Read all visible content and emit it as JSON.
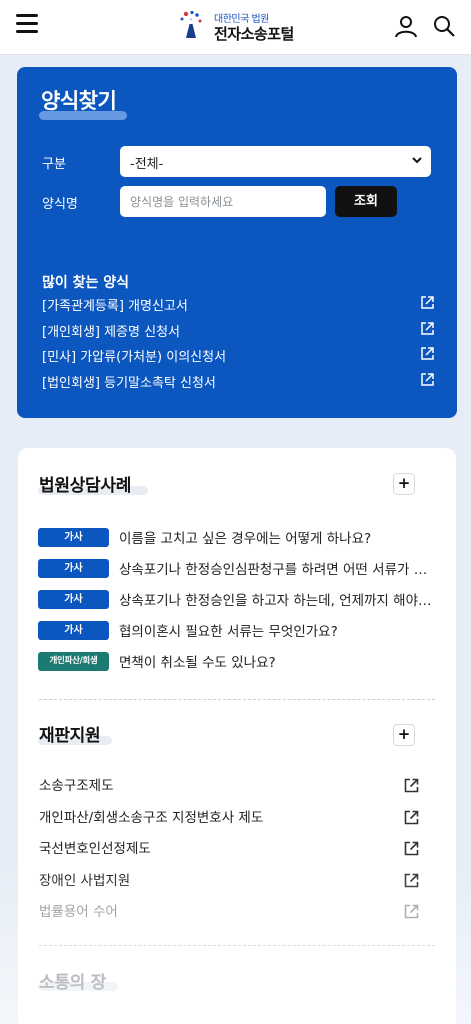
{
  "header": {
    "logo_sub": "대한민국 법원",
    "logo_title": "전자소송포털"
  },
  "finder": {
    "title": "양식찾기",
    "category_label": "구분",
    "category_value": "-전체-",
    "name_label": "양식명",
    "name_placeholder": "양식명을 입력하세요",
    "search_button": "조회",
    "popular_title": "많이 찾는 양식",
    "popular": [
      "[가족관계등록] 개명신고서",
      "[개인회생] 제증명 신청서",
      "[민사] 가압류(가처분) 이의신청서",
      "[법인회생] 등기말소촉탁 신청서"
    ]
  },
  "consult": {
    "title": "법원상담사례",
    "plus": "+",
    "items": [
      {
        "badge": "가사",
        "text": "이름을 고치고 싶은 경우에는 어떻게 하나요?"
      },
      {
        "badge": "가사",
        "text": "상속포기나 한정승인심판청구를 하려면 어떤 서류가 필요한가요?"
      },
      {
        "badge": "가사",
        "text": "상속포기나 한정승인을 하고자 하는데, 언제까지 해야 하나요?"
      },
      {
        "badge": "가사",
        "text": "협의이혼시 필요한 서류는 무엇인가요?"
      },
      {
        "badge": "개인파산/회생",
        "text": "면책이 취소될 수도 있나요?"
      }
    ]
  },
  "support": {
    "title": "재판지원",
    "plus": "+",
    "items": [
      "소송구조제도",
      "개인파산/회생소송구조 지정변호사 제도",
      "국선변호인선정제도",
      "장애인 사법지원",
      "법률용어 수어"
    ]
  },
  "community": {
    "title": "소통의 장"
  },
  "colors": {
    "primary": "#0b56bf",
    "badge_green": "#1c7a72",
    "page_bg": "#e6edf6"
  }
}
